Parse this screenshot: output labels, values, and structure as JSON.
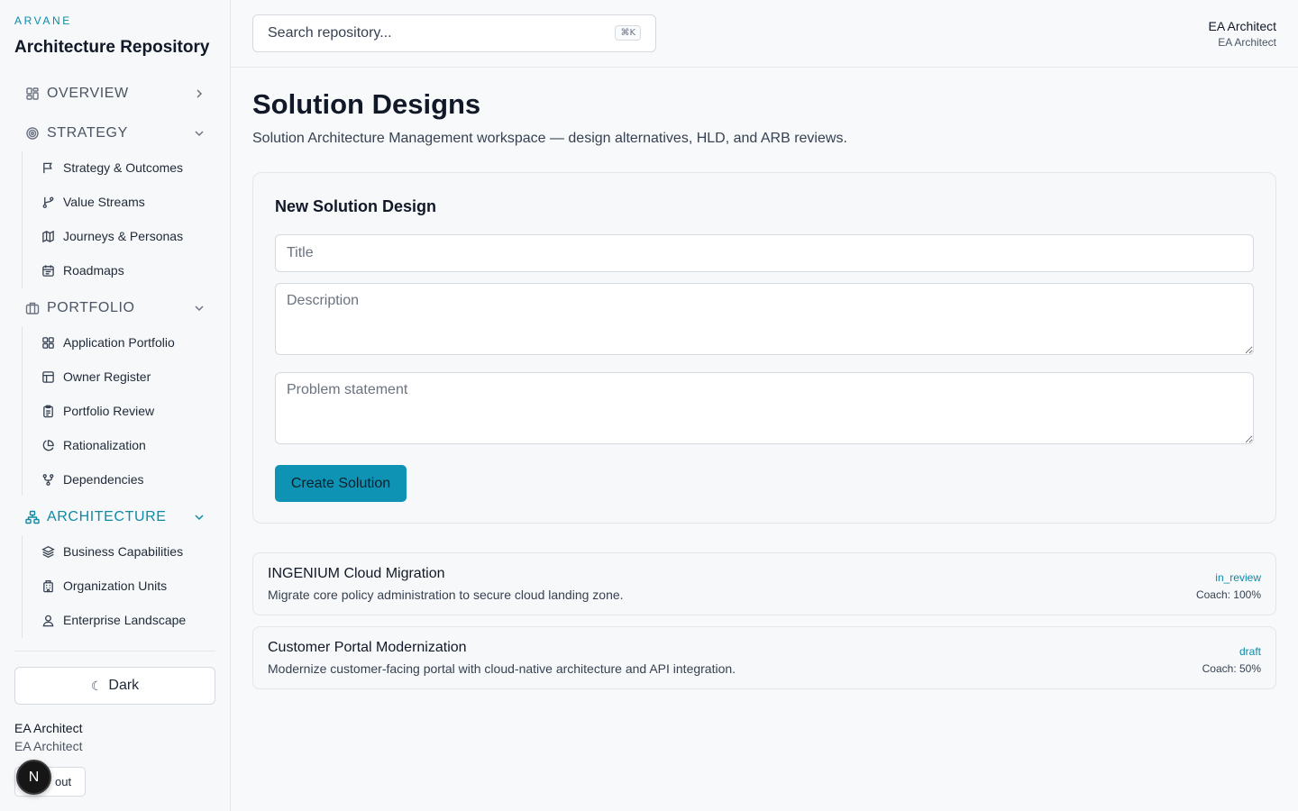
{
  "app": {
    "brand": "ARVANE",
    "title": "Architecture Repository"
  },
  "sidebar": {
    "sections": [
      {
        "label": "OVERVIEW",
        "icon": "layout-grid-icon",
        "expanded": false
      },
      {
        "label": "STRATEGY",
        "icon": "target-icon",
        "expanded": true
      },
      {
        "label": "PORTFOLIO",
        "icon": "briefcase-icon",
        "expanded": true
      },
      {
        "label": "ARCHITECTURE",
        "icon": "network-icon",
        "expanded": true,
        "active": true
      }
    ],
    "strategy_items": [
      {
        "label": "Strategy & Outcomes",
        "icon": "flag-icon"
      },
      {
        "label": "Value Streams",
        "icon": "git-branch-icon"
      },
      {
        "label": "Journeys & Personas",
        "icon": "map-icon"
      },
      {
        "label": "Roadmaps",
        "icon": "calendar-icon"
      }
    ],
    "portfolio_items": [
      {
        "label": "Application Portfolio",
        "icon": "grid-icon"
      },
      {
        "label": "Owner Register",
        "icon": "table-icon"
      },
      {
        "label": "Portfolio Review",
        "icon": "clipboard-icon"
      },
      {
        "label": "Rationalization",
        "icon": "pie-chart-icon"
      },
      {
        "label": "Dependencies",
        "icon": "git-fork-icon"
      }
    ],
    "architecture_items": [
      {
        "label": "Business Capabilities",
        "icon": "layers-icon"
      },
      {
        "label": "Organization Units",
        "icon": "building-icon"
      },
      {
        "label": "Enterprise Landscape",
        "icon": "user-icon"
      }
    ],
    "theme_toggle": "Dark",
    "user": {
      "name": "EA Architect",
      "role": "EA Architect"
    },
    "signout_label": "out",
    "avatar_letter": "N"
  },
  "topbar": {
    "search_placeholder": "Search repository...",
    "shortcut": "⌘K",
    "user_name": "EA Architect",
    "user_role": "EA Architect"
  },
  "main": {
    "title": "Solution Designs",
    "subtitle": "Solution Architecture Management workspace — design alternatives, HLD, and ARB reviews.",
    "form": {
      "heading": "New Solution Design",
      "title_placeholder": "Title",
      "description_placeholder": "Description",
      "problem_placeholder": "Problem statement",
      "submit_label": "Create Solution"
    },
    "solutions": [
      {
        "title": "INGENIUM Cloud Migration",
        "description": "Migrate core policy administration to secure cloud landing zone.",
        "status": "in_review",
        "coach": "Coach: 100%"
      },
      {
        "title": "Customer Portal Modernization",
        "description": "Modernize customer-facing portal with cloud-native architecture and API integration.",
        "status": "draft",
        "coach": "Coach: 50%"
      }
    ]
  },
  "colors": {
    "accent": "#0e8aa6",
    "button": "#0e93b5",
    "background": "#f7f9fb"
  }
}
